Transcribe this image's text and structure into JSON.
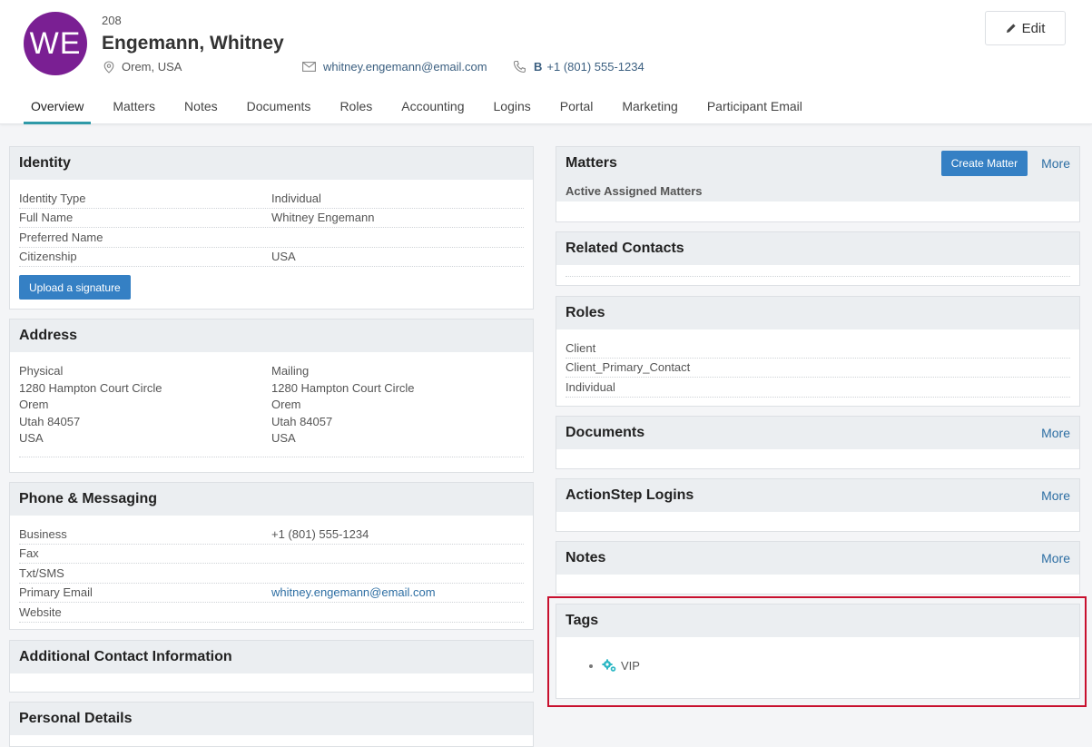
{
  "contact": {
    "initials": "WE",
    "id": "208",
    "name": "Engemann, Whitney",
    "location": "Orem, USA",
    "email": "whitney.engemann@email.com",
    "phone_type": "B",
    "phone": "+1 (801) 555-1234",
    "avatar_color": "#7a1f93"
  },
  "header": {
    "edit_label": "Edit"
  },
  "tabs": [
    {
      "label": "Overview",
      "active": true
    },
    {
      "label": "Matters"
    },
    {
      "label": "Notes"
    },
    {
      "label": "Documents"
    },
    {
      "label": "Roles"
    },
    {
      "label": "Accounting"
    },
    {
      "label": "Logins"
    },
    {
      "label": "Portal"
    },
    {
      "label": "Marketing"
    },
    {
      "label": "Participant Email"
    }
  ],
  "identity": {
    "title": "Identity",
    "rows": [
      {
        "k": "Identity Type",
        "v": "Individual"
      },
      {
        "k": "Full Name",
        "v": "Whitney Engemann"
      },
      {
        "k": "Preferred Name",
        "v": ""
      },
      {
        "k": "Citizenship",
        "v": "USA"
      }
    ],
    "upload_label": "Upload a signature"
  },
  "address": {
    "title": "Address",
    "physical": {
      "label": "Physical",
      "street": "1280 Hampton Court Circle",
      "city": "Orem",
      "state": "Utah 84057",
      "country": "USA"
    },
    "mailing": {
      "label": "Mailing",
      "street": "1280 Hampton Court Circle",
      "city": "Orem",
      "state": "Utah 84057",
      "country": "USA"
    }
  },
  "phone_messaging": {
    "title": "Phone & Messaging",
    "rows": [
      {
        "k": "Business",
        "v": "+1 (801) 555-1234"
      },
      {
        "k": "Fax",
        "v": ""
      },
      {
        "k": "Txt/SMS",
        "v": ""
      },
      {
        "k": "Primary Email",
        "v": "whitney.engemann@email.com"
      },
      {
        "k": "Website",
        "v": ""
      }
    ]
  },
  "additional": {
    "title": "Additional Contact Information"
  },
  "personal": {
    "title": "Personal Details"
  },
  "matters": {
    "title": "Matters",
    "create_label": "Create Matter",
    "more_label": "More",
    "sub_head": "Active Assigned Matters"
  },
  "related": {
    "title": "Related Contacts"
  },
  "roles": {
    "title": "Roles",
    "items": [
      "Client",
      "Client_Primary_Contact",
      "Individual"
    ]
  },
  "documents": {
    "title": "Documents",
    "more_label": "More"
  },
  "logins": {
    "title": "ActionStep Logins",
    "more_label": "More"
  },
  "notes": {
    "title": "Notes",
    "more_label": "More"
  },
  "tags": {
    "title": "Tags",
    "items": [
      "VIP"
    ],
    "icon_color": "#2bb7c4"
  }
}
